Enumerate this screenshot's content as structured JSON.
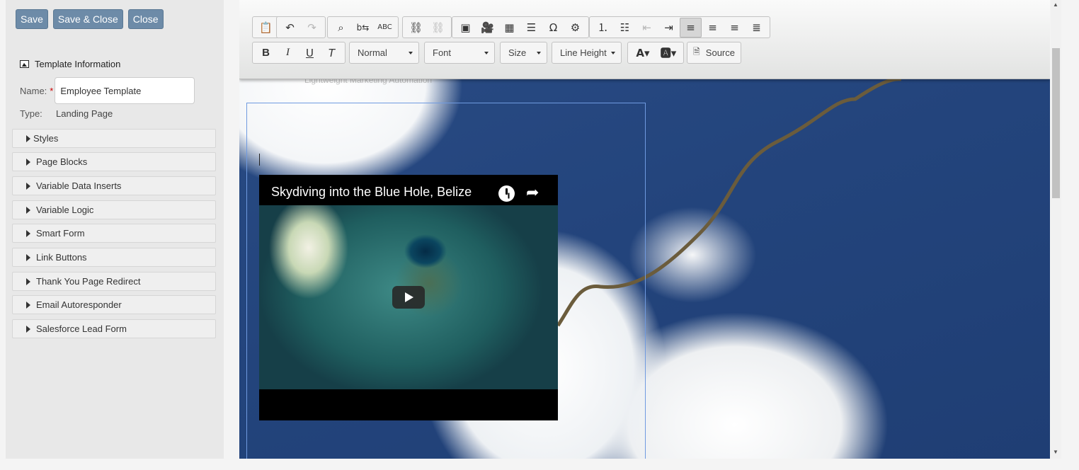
{
  "actions": {
    "save": "Save",
    "save_close": "Save & Close",
    "close": "Close"
  },
  "template_info": {
    "heading": "Template Information",
    "name_label": "Name:",
    "required_mark": "*",
    "name_value": "Employee Template",
    "type_label": "Type:",
    "type_value": "Landing Page"
  },
  "sections": [
    "Styles",
    "Page Blocks",
    "Variable Data Inserts",
    "Variable Logic",
    "Smart Form",
    "Link Buttons",
    "Thank You Page Redirect",
    "Email Autoresponder",
    "Salesforce Lead Form"
  ],
  "toolbar": {
    "format": "Normal",
    "font": "Font",
    "size": "Size",
    "line_height": "Line Height",
    "source": "Source",
    "icons_row1": [
      "paste-from-word-icon",
      "undo-icon",
      "redo-icon",
      "find-icon",
      "replace-icon",
      "spellcheck-icon",
      "link-icon",
      "unlink-icon",
      "image-icon",
      "video-icon",
      "table-icon",
      "horizontal-line-icon",
      "special-char-icon",
      "settings-icon",
      "numbered-list-icon",
      "bulleted-list-icon",
      "outdent-icon",
      "indent-icon",
      "align-left-icon",
      "align-center-icon",
      "align-right-icon",
      "justify-icon"
    ],
    "active_alignment": "align-left"
  },
  "canvas": {
    "tagline": "Lightweight Marketing Automation",
    "video_title": "Skydiving into the Blue Hole, Belize"
  },
  "colors": {
    "button": "#6d8ba8",
    "selection_border": "#6f9ae0",
    "sky": "#2a4c85"
  }
}
